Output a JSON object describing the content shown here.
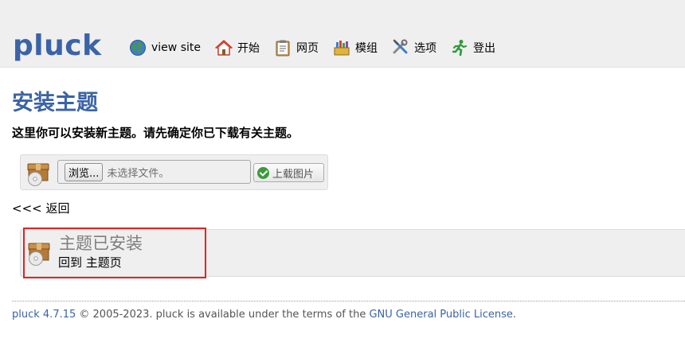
{
  "header": {
    "logo": "pluck",
    "nav": [
      {
        "label": "view site",
        "icon": "globe-icon"
      },
      {
        "label": "开始",
        "icon": "home-icon"
      },
      {
        "label": "网页",
        "icon": "page-icon"
      },
      {
        "label": "模组",
        "icon": "modules-icon"
      },
      {
        "label": "选项",
        "icon": "tools-icon"
      },
      {
        "label": "登出",
        "icon": "logout-running-icon"
      }
    ]
  },
  "main": {
    "title": "安装主题",
    "intro": "这里你可以安装新主题。请先确定你已下载有关主题。",
    "upload": {
      "browse_label": "浏览...",
      "no_file_text": "未选择文件。",
      "submit_label": "上载图片",
      "icon": "theme-package-icon"
    },
    "back_link": "<<< 返回",
    "success": {
      "title": "主题已安装",
      "back_prefix": "回到",
      "back_link": "主题页",
      "icon": "theme-package-icon"
    }
  },
  "footer": {
    "version_link": "pluck 4.7.15",
    "text": " © 2005-2023. pluck is available under the terms of the ",
    "license_link": "GNU General Public License",
    "end": "."
  },
  "colors": {
    "brand": "#3b63a6",
    "highlight": "#e02424",
    "success_check": "#3a9a3a"
  }
}
